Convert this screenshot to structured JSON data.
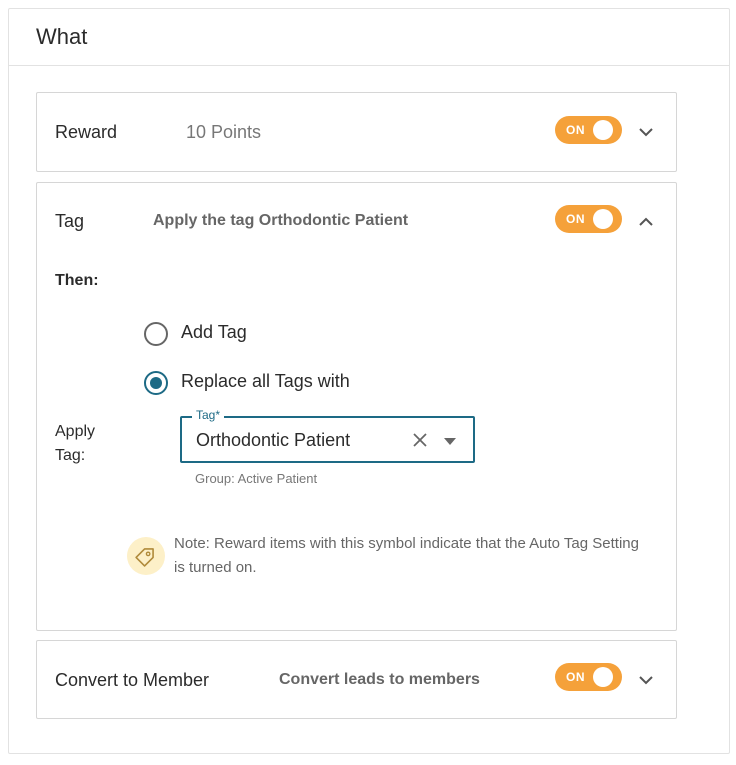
{
  "card": {
    "title": "What"
  },
  "reward": {
    "title": "Reward",
    "summary": "10 Points",
    "toggle_label": "ON"
  },
  "tag": {
    "title": "Tag",
    "summary": "Apply the tag Orthodontic Patient",
    "toggle_label": "ON",
    "then_label": "Then:",
    "options": [
      "Add Tag",
      "Replace all Tags with"
    ],
    "selected_option": "Replace all Tags with",
    "apply_label": "Apply Tag:",
    "field_label": "Tag*",
    "field_value": "Orthodontic Patient",
    "group_text": "Group: Active Patient",
    "note": "Note: Reward items with this symbol indicate that the Auto Tag Setting is turned on.",
    "note_icon": "tag-icon"
  },
  "convert": {
    "title": "Convert to Member",
    "summary": "Convert leads to members",
    "toggle_label": "ON"
  },
  "colors": {
    "accent": "#1d6a85",
    "toggle_on": "#f5a13a",
    "note_icon_bg": "#fdf0c8"
  }
}
